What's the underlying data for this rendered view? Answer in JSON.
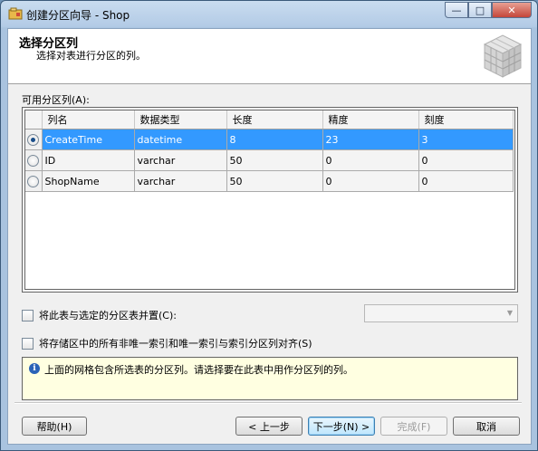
{
  "window": {
    "title": "创建分区向导 - Shop",
    "minimize_label": "—",
    "maximize_label": "□",
    "close_label": "✕"
  },
  "header": {
    "title": "选择分区列",
    "subtitle": "选择对表进行分区的列。"
  },
  "grid": {
    "label": "可用分区列(A):",
    "columns": [
      "列名",
      "数据类型",
      "长度",
      "精度",
      "刻度"
    ],
    "rows": [
      {
        "name": "CreateTime",
        "type": "datetime",
        "length": "8",
        "precision": "23",
        "scale": "3",
        "selected": true
      },
      {
        "name": "ID",
        "type": "varchar",
        "length": "50",
        "precision": "0",
        "scale": "0",
        "selected": false
      },
      {
        "name": "ShopName",
        "type": "varchar",
        "length": "50",
        "precision": "0",
        "scale": "0",
        "selected": false
      }
    ]
  },
  "options": {
    "collocate_label": "将此表与选定的分区表并置(C):",
    "collocate_checked": false,
    "collocate_combo_value": "",
    "align_label": "将存储区中的所有非唯一索引和唯一索引与索引分区列对齐(S)",
    "align_checked": false
  },
  "info": {
    "text": "上面的网格包含所选表的分区列。请选择要在此表中用作分区列的列。"
  },
  "buttons": {
    "help": "帮助(H)",
    "back": "< 上一步",
    "next": "下一步(N) >",
    "finish": "完成(F)",
    "cancel": "取消"
  },
  "colors": {
    "selection": "#3399ff",
    "info_background": "#ffffe1"
  }
}
